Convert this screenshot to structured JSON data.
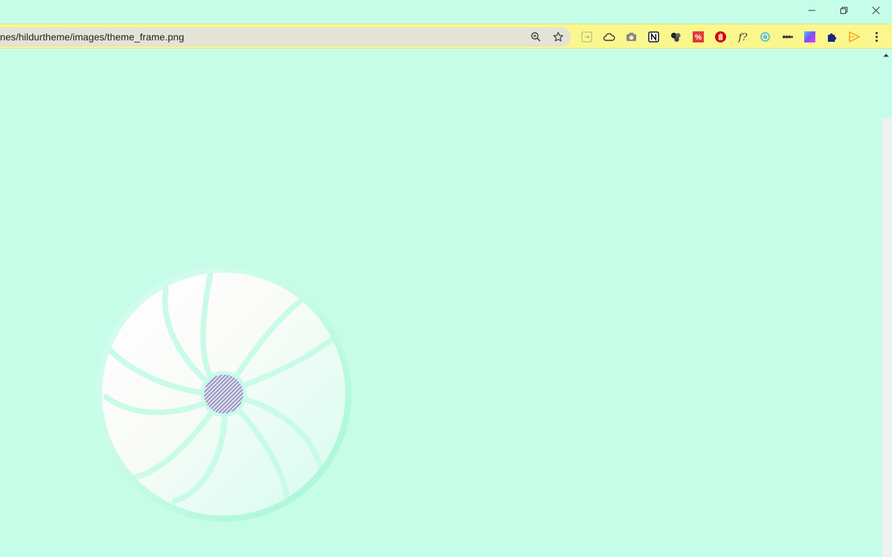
{
  "window": {
    "minimize_label": "Minimize",
    "restore_label": "Restore",
    "close_label": "Close"
  },
  "toolbar": {
    "url": "nes/hildurtheme/images/theme_frame.png",
    "zoom_icon": "zoom-icon",
    "bookmark_icon": "star-icon"
  },
  "extensions": [
    {
      "name": "sidepanel-icon"
    },
    {
      "name": "cloud-icon"
    },
    {
      "name": "camera-icon"
    },
    {
      "name": "notion-icon"
    },
    {
      "name": "balls-icon"
    },
    {
      "name": "percent-icon"
    },
    {
      "name": "stop-hand-icon"
    },
    {
      "name": "formula-icon"
    },
    {
      "name": "chatgpt-icon"
    },
    {
      "name": "dots-icon"
    },
    {
      "name": "gradient-square-icon"
    },
    {
      "name": "puzzle-icon"
    },
    {
      "name": "play-arrow-icon"
    },
    {
      "name": "kebab-menu-icon"
    }
  ],
  "colors": {
    "page_bg": "#c6fde8",
    "toolbar_bg": "#f9f78e",
    "omnibox_bg": "#e3e3d6"
  }
}
